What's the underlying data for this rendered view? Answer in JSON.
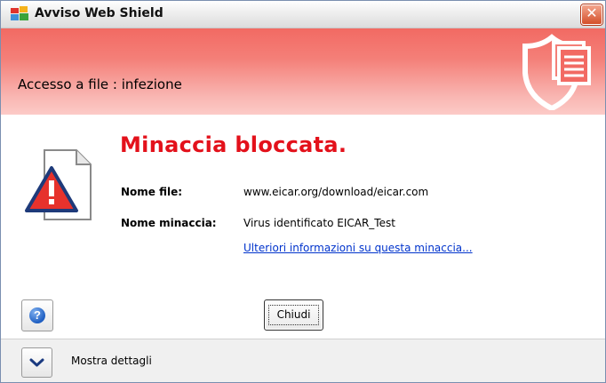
{
  "window": {
    "title": "Avviso Web Shield",
    "close_symbol": "✕"
  },
  "header": {
    "title": "Accesso a file : infezione",
    "icon": "shield-document-icon"
  },
  "alert": {
    "headline": "Minaccia bloccata.",
    "file_label": "Nome file:",
    "file_value": "www.eicar.org/download/eicar.com",
    "threat_label": "Nome minaccia:",
    "threat_value": "Virus identificato EICAR_Test",
    "more_info_link": "Ulteriori informazioni su questa minaccia..."
  },
  "buttons": {
    "help_symbol": "?",
    "close_label": "Chiudi",
    "details_label": "Mostra dettagli"
  },
  "colors": {
    "headline_red": "#e3111b",
    "header_gradient_top": "#f26a63",
    "link_blue": "#0033cc"
  }
}
